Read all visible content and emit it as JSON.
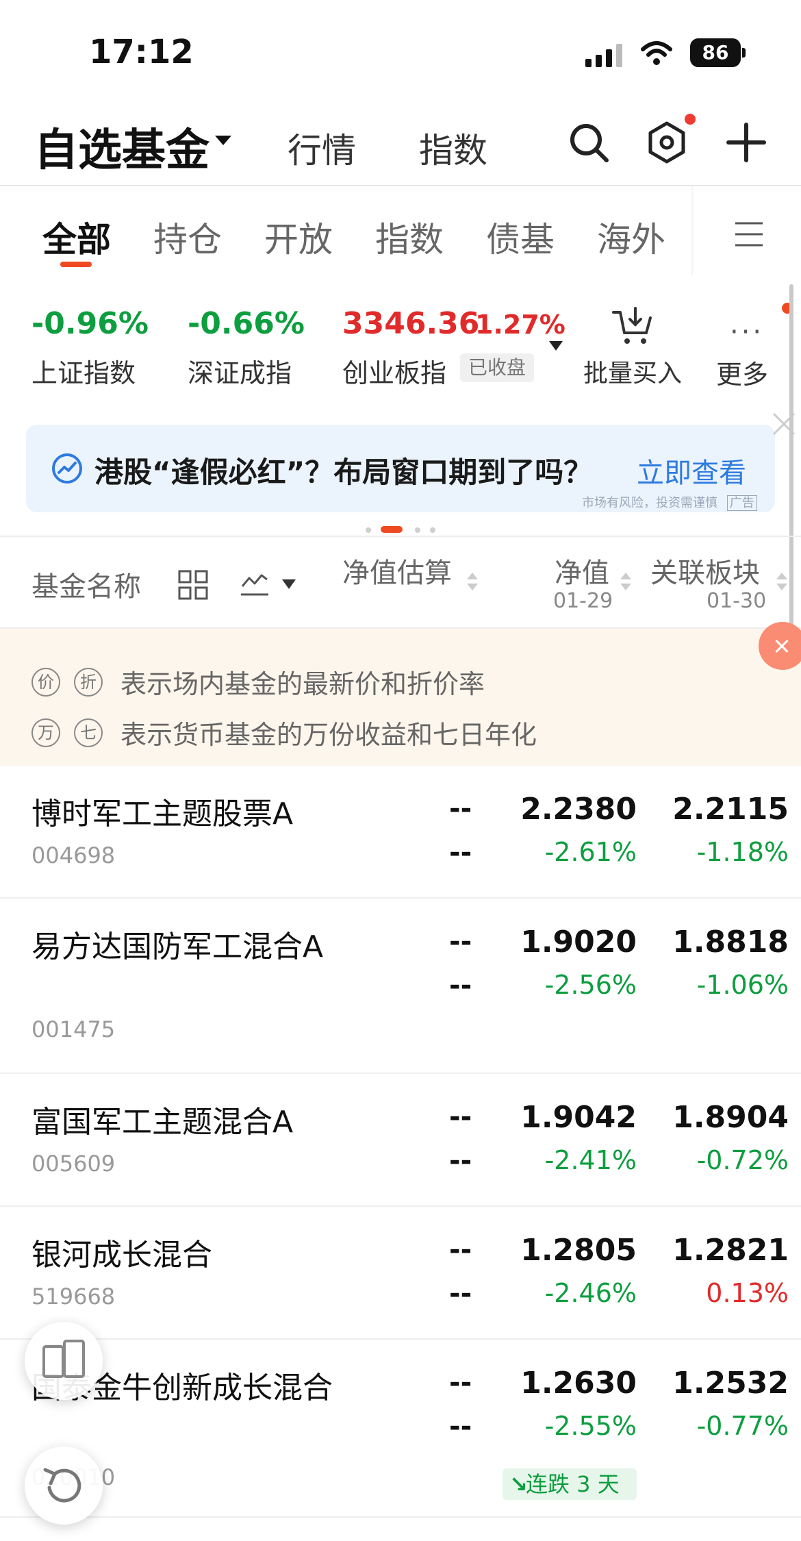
{
  "status_bar": {
    "time": "17:12",
    "battery": "86"
  },
  "header": {
    "title": "自选基金",
    "nav": [
      "行情",
      "指数"
    ]
  },
  "tabs": {
    "items": [
      "全部",
      "持仓",
      "开放",
      "指数",
      "债基",
      "海外"
    ]
  },
  "indices": {
    "items": [
      {
        "value": "-0.96%",
        "name": "上证指数"
      },
      {
        "value": "-0.66%",
        "name": "深证成指"
      },
      {
        "value": "3346.36",
        "change": "1.27%",
        "name": "创业板指",
        "badge": "已收盘"
      }
    ],
    "batch_buy": "批量买入",
    "more": "更多"
  },
  "banner": {
    "text": "港股“逢假必红”？布局窗口期到了吗？",
    "link": "立即查看",
    "disclaimer": "市场有风险，投资需谨慎",
    "ad_tag": "广告"
  },
  "table_header": {
    "name": "基金名称",
    "estimate": "净值估算",
    "nav": "净值",
    "nav_date": "01-29",
    "related": "关联板块",
    "related_date": "01-30"
  },
  "notice": {
    "row1": {
      "icons": [
        "价",
        "折"
      ],
      "text": "表示场内基金的最新价和折价率"
    },
    "row2": {
      "icons": [
        "万",
        "七"
      ],
      "text": "表示货币基金的万份收益和七日年化"
    }
  },
  "funds": [
    {
      "name": "博时军工主题股票A",
      "code": "004698",
      "est1": "--",
      "est2": "--",
      "nav": "2.2380",
      "nav_change": "-2.61%",
      "related": "2.2115",
      "related_change": "-1.18%"
    },
    {
      "name": "易方达国防军工混合A",
      "code": "001475",
      "est1": "--",
      "est2": "--",
      "nav": "1.9020",
      "nav_change": "-2.56%",
      "related": "1.8818",
      "related_change": "-1.06%"
    },
    {
      "name": "富国军工主题混合A",
      "code": "005609",
      "est1": "--",
      "est2": "--",
      "nav": "1.9042",
      "nav_change": "-2.41%",
      "related": "1.8904",
      "related_change": "-0.72%"
    },
    {
      "name": "银河成长混合",
      "code": "519668",
      "est1": "--",
      "est2": "--",
      "nav": "1.2805",
      "nav_change": "-2.46%",
      "related": "1.2821",
      "related_change": "0.13%"
    },
    {
      "name": "国泰金牛创新成长混合",
      "code": "020010",
      "est1": "--",
      "est2": "--",
      "nav": "1.2630",
      "nav_change": "-2.55%",
      "related": "1.2532",
      "related_change": "-0.77%",
      "badge": "连跌 3 天"
    }
  ],
  "colors": {
    "up": "#e12a2a",
    "down": "#0d9e3f",
    "accent": "#f04a23",
    "link": "#2d7be0"
  }
}
